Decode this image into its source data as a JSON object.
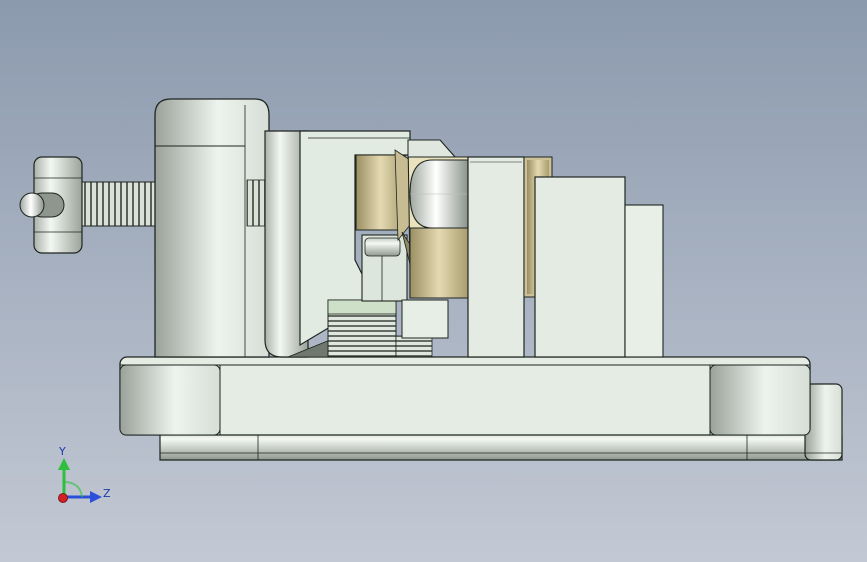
{
  "viewport": {
    "background_top": "#8c9aae",
    "background_bottom": "#c3c9d4"
  },
  "triad": {
    "y_label": "Y",
    "z_label": "Z",
    "y_color": "#2fbf3a",
    "z_color": "#2a4fd8",
    "x_color": "#d42020"
  },
  "model": {
    "body_color": "#dbe6db",
    "edge_color": "#1e2520",
    "bronze_color": "#d6c9a0",
    "cream_color": "#eae2bc"
  }
}
